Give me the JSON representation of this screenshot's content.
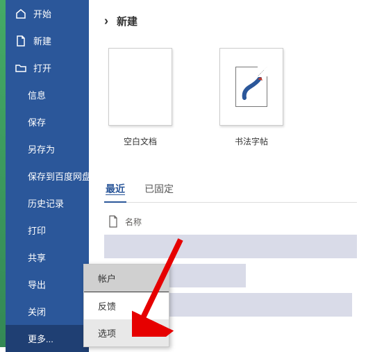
{
  "sidebar": {
    "start": "开始",
    "new": "新建",
    "open": "打开",
    "info": "信息",
    "save": "保存",
    "saveAs": "另存为",
    "saveToBaidu": "保存到百度网盘",
    "history": "历史记录",
    "print": "打印",
    "share": "共享",
    "export": "导出",
    "close": "关闭",
    "more": "更多..."
  },
  "page": {
    "title": "新建",
    "arrow": "›"
  },
  "templates": {
    "blank": "空白文档",
    "calligraphy": "书法字帖"
  },
  "tabs": {
    "recent": "最近",
    "pinned": "已固定"
  },
  "list": {
    "nameHeader": "名称"
  },
  "popup": {
    "account": "帐户",
    "feedback": "反馈",
    "options": "选项"
  },
  "colors": {
    "brand": "#2b579a"
  }
}
